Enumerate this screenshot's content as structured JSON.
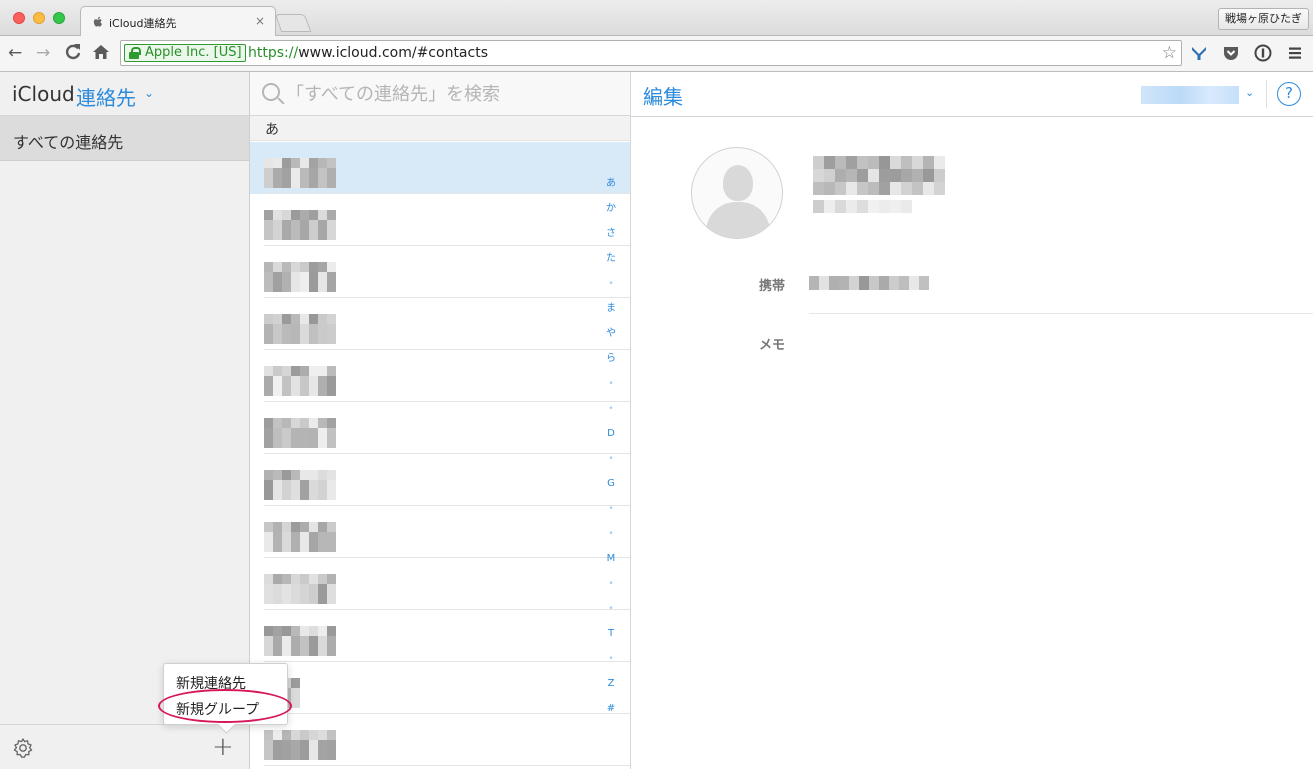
{
  "browser": {
    "tab_title": "iCloud連絡先",
    "tab_close": "×",
    "profile_name": "戦場ヶ原ひたぎ",
    "ev_label": "Apple Inc. [US]",
    "url_scheme": "https://",
    "url_rest": "www.icloud.com/#contacts",
    "nav": {
      "back": "←",
      "forward": "→",
      "reload": "C",
      "home": "⌂"
    },
    "extensions": [
      "Y",
      "pocket",
      "1password",
      "menu"
    ]
  },
  "sidebar": {
    "app_name": "iCloud",
    "section": "連絡先",
    "chevron": "⌄",
    "groups": [
      {
        "label": "すべての連絡先",
        "selected": true
      }
    ],
    "footer": {
      "settings_icon": "gear-icon",
      "add_icon": "plus-icon",
      "add_glyph": "+"
    }
  },
  "popover": {
    "items": [
      {
        "label": "新規連絡先"
      },
      {
        "label": "新規グループ",
        "highlighted": true
      }
    ]
  },
  "list": {
    "search_placeholder": "「すべての連絡先」を検索",
    "section_header": "あ",
    "row_count": 12,
    "selected_row": 0,
    "index": [
      "あ",
      "か",
      "さ",
      "た",
      "•",
      "ま",
      "や",
      "ら",
      "•",
      "•",
      "D",
      "•",
      "G",
      "•",
      "•",
      "M",
      "•",
      "•",
      "T",
      "•",
      "Z",
      "#"
    ]
  },
  "detail": {
    "edit_label": "編集",
    "help_glyph": "?",
    "chevron": "⌄",
    "fields": [
      {
        "label": "携帯"
      },
      {
        "label": "メモ"
      }
    ]
  },
  "colors": {
    "accent": "#2d8bdc",
    "selection": "#d8e9f8",
    "highlight_ring": "#d6175c"
  }
}
